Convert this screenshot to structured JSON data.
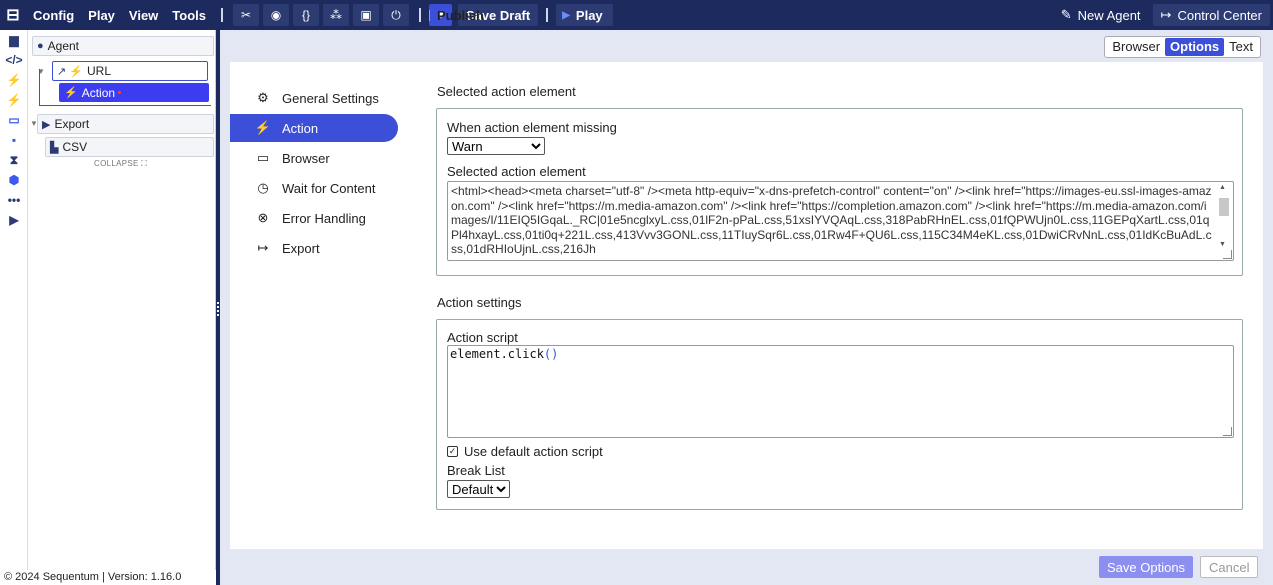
{
  "topbar": {
    "logo": "⊟",
    "menus": [
      "Config",
      "Play",
      "View",
      "Tools"
    ],
    "publish_label": "Publish",
    "save_draft_label": "Save Draft",
    "play_label": "Play",
    "new_agent_label": "New Agent",
    "control_center_label": "Control Center"
  },
  "tree": {
    "agent_label": "Agent",
    "url_label": "URL",
    "action_label": "Action",
    "export_label": "Export",
    "csv_label": "CSV",
    "collapse_label": "COLLAPSE ⛶"
  },
  "footer": {
    "text": "© 2024 Sequentum | Version: 1.16.0"
  },
  "view_tabs": [
    "Browser",
    "Options",
    "Text"
  ],
  "settings_nav": [
    {
      "label": "General Settings",
      "icon": "⚙"
    },
    {
      "label": "Action",
      "icon": "⚡"
    },
    {
      "label": "Browser",
      "icon": "▭"
    },
    {
      "label": "Wait for Content",
      "icon": "◷"
    },
    {
      "label": "Error Handling",
      "icon": "⊗"
    },
    {
      "label": "Export",
      "icon": "↦"
    }
  ],
  "selected_section": {
    "title": "Selected action element",
    "missing_label": "When action element missing",
    "missing_value": "Warn",
    "element_label": "Selected action element",
    "element_html": "<html><head><meta charset=\"utf-8\" /><meta http-equiv=\"x-dns-prefetch-control\" content=\"on\" /><link href=\"https://images-eu.ssl-images-amazon.com\" /><link href=\"https://m.media-amazon.com\" /><link href=\"https://completion.amazon.com\" /><link href=\"https://m.media-amazon.com/images/I/11EIQ5IGqaL._RC|01e5ncglxyL.css,01lF2n-pPaL.css,51xsIYVQAqL.css,318PabRHnEL.css,01fQPWUjn0L.css,11GEPqXartL.css,01qPl4hxayL.css,01ti0q+221L.css,413Vvv3GONL.css,11TIuySqr6L.css,01Rw4F+QU6L.css,115C34M4eKL.css,01DwiCRvNnL.css,01IdKcBuAdL.css,01dRHIoUjnL.css,216Jh"
  },
  "action_section": {
    "title": "Action settings",
    "script_label": "Action script",
    "script_code": "element.click",
    "script_parens": "()",
    "use_default_label": "Use default action script",
    "break_label": "Break List",
    "break_value": "Default"
  },
  "buttons": {
    "save_options": "Save Options",
    "cancel": "Cancel"
  }
}
